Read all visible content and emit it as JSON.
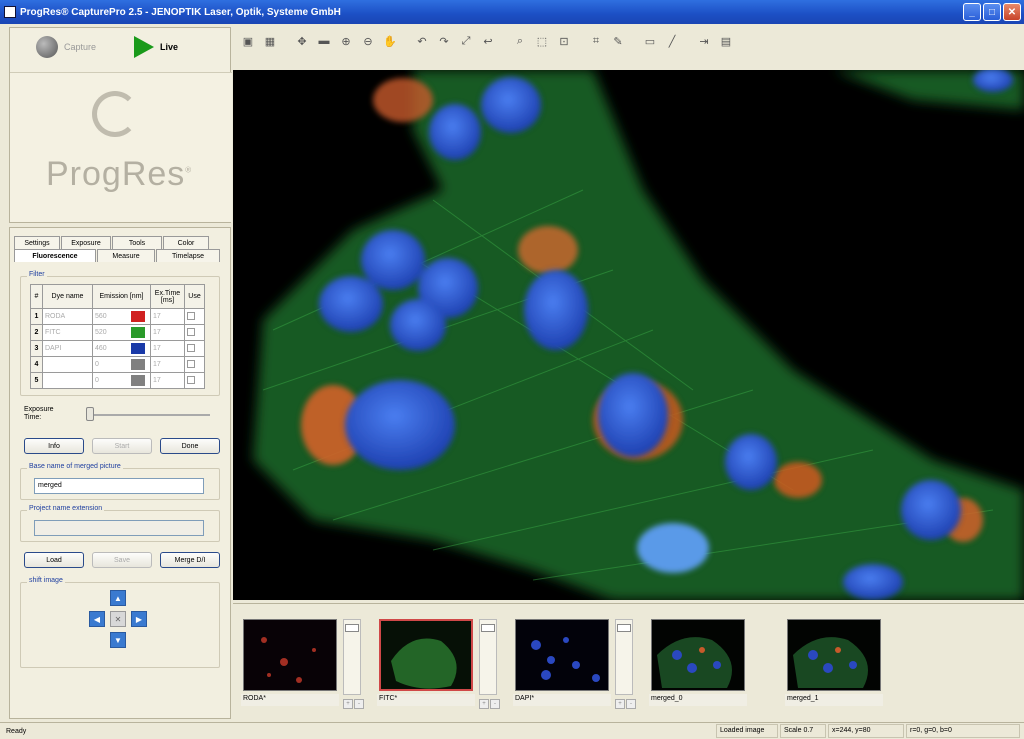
{
  "window": {
    "title": "ProgRes® CapturePro 2.5 - JENOPTIK Laser, Optik, Systeme GmbH"
  },
  "capture": {
    "capture_label": "Capture",
    "live_label": "Live",
    "brand": "ProgRes",
    "brand_mark": "®"
  },
  "tabs": {
    "row1": [
      "Settings",
      "Exposure",
      "Tools",
      "Color"
    ],
    "row2": [
      "Fluorescence",
      "Measure",
      "Timelapse"
    ],
    "active": "Fluorescence"
  },
  "filter": {
    "title": "Filter",
    "headers": [
      "#",
      "Dye name",
      "Emission [nm]",
      "Ex.Time [ms]",
      "Use"
    ],
    "rows": [
      {
        "n": "1",
        "dye": "RODA",
        "em": "560",
        "color": "#d02020",
        "ex": "17"
      },
      {
        "n": "2",
        "dye": "FITC",
        "em": "520",
        "color": "#2a9a2a",
        "ex": "17"
      },
      {
        "n": "3",
        "dye": "DAPI",
        "em": "460",
        "color": "#1a3aa8",
        "ex": "17"
      },
      {
        "n": "4",
        "dye": "",
        "em": "0",
        "color": "#808080",
        "ex": "17"
      },
      {
        "n": "5",
        "dye": "",
        "em": "0",
        "color": "#808080",
        "ex": "17"
      }
    ]
  },
  "exposure": {
    "label_line1": "Exposure",
    "label_line2": "Time:"
  },
  "buttons": {
    "info": "Info",
    "start": "Start",
    "done": "Done",
    "load": "Load",
    "save": "Save",
    "merge": "Merge D/I"
  },
  "merged": {
    "title": "Base name of merged picture",
    "value": "merged"
  },
  "project": {
    "title": "Project name extension",
    "value": ""
  },
  "shift": {
    "title": "shift image"
  },
  "thumbnails": [
    {
      "label": "RODA*"
    },
    {
      "label": "FITC*"
    },
    {
      "label": "DAPI*"
    },
    {
      "label": "merged_0"
    },
    {
      "label": "merged_1"
    }
  ],
  "status": {
    "left": "Ready",
    "loaded": "Loaded image",
    "scale": "Scale 0.7",
    "coords": "x=244, y=80",
    "rgb": "r=0, g=0, b=0"
  },
  "colors": {
    "title_bar": "#2458d0",
    "cell_green": "#2a9a3a",
    "nucleus_blue": "#2a5ad8",
    "mito_orange": "#d85a2a"
  }
}
